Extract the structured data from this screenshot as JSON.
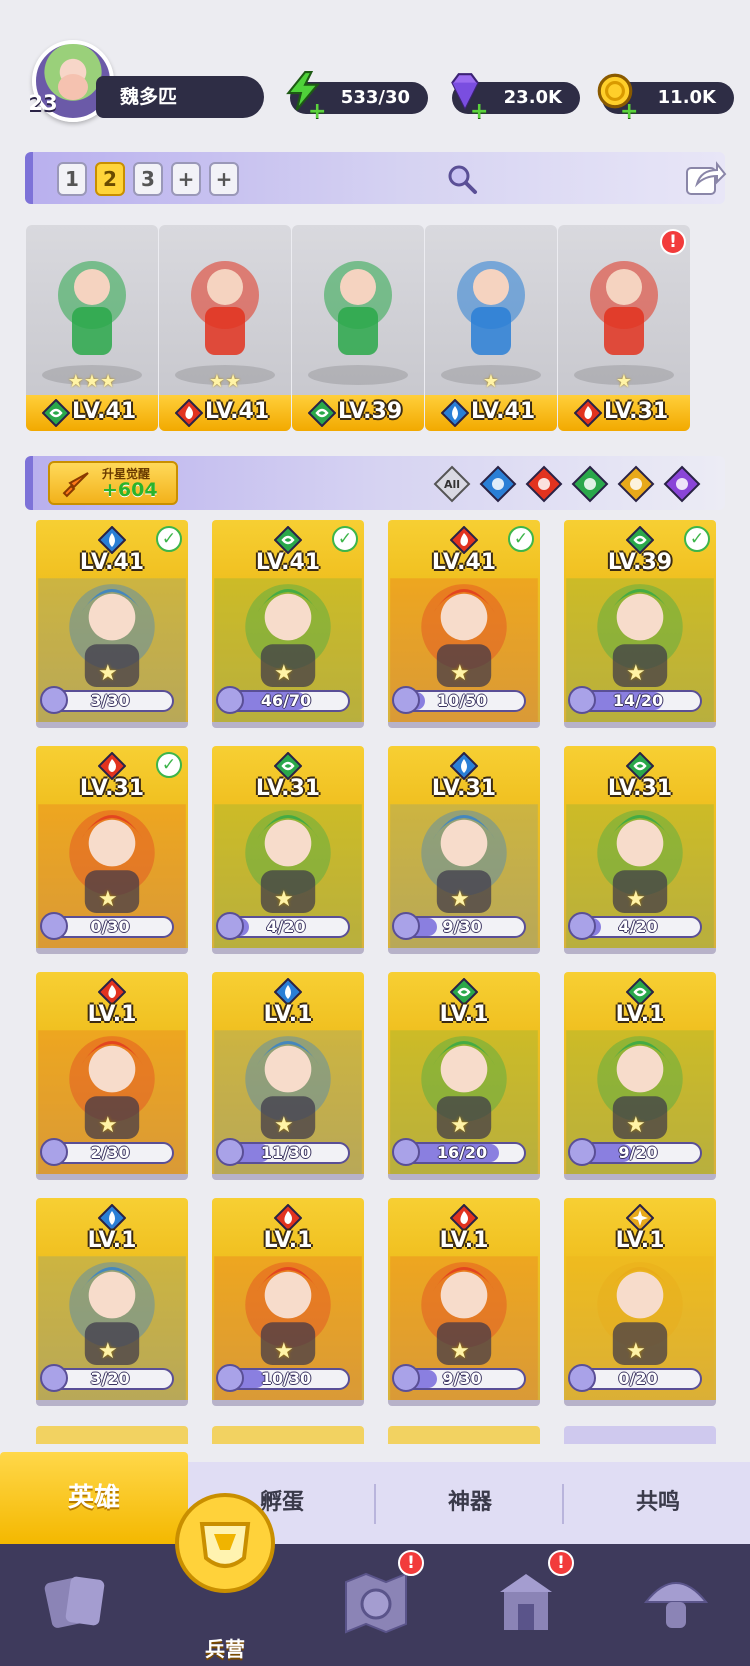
{
  "player": {
    "level": "23",
    "name": "魏多匹"
  },
  "resources": {
    "energy": "533/30",
    "gems": "23.0K",
    "gold": "11.0K"
  },
  "team_bar": {
    "slots": [
      "1",
      "2",
      "3",
      "+",
      "+"
    ],
    "active_slot": "2"
  },
  "team": [
    {
      "level": "LV.41",
      "element": "wind",
      "stars": "★★★",
      "alert": false
    },
    {
      "level": "LV.41",
      "element": "fire",
      "stars": "★★",
      "alert": false
    },
    {
      "level": "LV.39",
      "element": "wind",
      "stars": "",
      "alert": false
    },
    {
      "level": "LV.41",
      "element": "water",
      "stars": "★",
      "alert": false
    },
    {
      "level": "LV.31",
      "element": "fire",
      "stars": "★",
      "alert": true
    }
  ],
  "filter_bar": {
    "awaken_title": "升星觉醒",
    "awaken_count": "+604",
    "filters": [
      "All",
      "water",
      "fire",
      "wind",
      "light",
      "dark"
    ]
  },
  "heroes": [
    {
      "level": "LV.41",
      "element": "water",
      "progress": "3/30",
      "fraction": 0.1,
      "check": true
    },
    {
      "level": "LV.41",
      "element": "wind",
      "progress": "46/70",
      "fraction": 0.66,
      "check": true
    },
    {
      "level": "LV.41",
      "element": "fire",
      "progress": "10/50",
      "fraction": 0.2,
      "check": true
    },
    {
      "level": "LV.39",
      "element": "wind",
      "progress": "14/20",
      "fraction": 0.7,
      "check": true
    },
    {
      "level": "LV.31",
      "element": "fire",
      "progress": "0/30",
      "fraction": 0.0,
      "check": true
    },
    {
      "level": "LV.31",
      "element": "wind",
      "progress": "4/20",
      "fraction": 0.2,
      "check": false
    },
    {
      "level": "LV.31",
      "element": "water",
      "progress": "9/30",
      "fraction": 0.3,
      "check": false
    },
    {
      "level": "LV.31",
      "element": "wind",
      "progress": "4/20",
      "fraction": 0.2,
      "check": false
    },
    {
      "level": "LV.1",
      "element": "fire",
      "progress": "2/30",
      "fraction": 0.07,
      "check": false
    },
    {
      "level": "LV.1",
      "element": "water",
      "progress": "11/30",
      "fraction": 0.37,
      "check": false
    },
    {
      "level": "LV.1",
      "element": "wind",
      "progress": "16/20",
      "fraction": 0.8,
      "check": false
    },
    {
      "level": "LV.1",
      "element": "wind",
      "progress": "9/20",
      "fraction": 0.45,
      "check": false
    },
    {
      "level": "LV.1",
      "element": "water",
      "progress": "3/20",
      "fraction": 0.15,
      "check": false
    },
    {
      "level": "LV.1",
      "element": "fire",
      "progress": "10/30",
      "fraction": 0.33,
      "check": false
    },
    {
      "level": "LV.1",
      "element": "fire",
      "progress": "9/30",
      "fraction": 0.3,
      "check": false
    },
    {
      "level": "LV.1",
      "element": "light",
      "progress": "0/20",
      "fraction": 0.0,
      "check": false
    }
  ],
  "subtabs": [
    "英雄",
    "孵蛋",
    "神器",
    "共鸣"
  ],
  "bottom_nav": [
    {
      "label": "",
      "icon": "cards-icon",
      "alert": false
    },
    {
      "label": "兵营",
      "icon": "barracks-icon",
      "alert": false,
      "active": true
    },
    {
      "label": "",
      "icon": "map-icon",
      "alert": true
    },
    {
      "label": "",
      "icon": "temple-icon",
      "alert": true
    },
    {
      "label": "",
      "icon": "mushroom-icon",
      "alert": false
    }
  ],
  "colors": {
    "fire": "#e2331f",
    "water": "#2a7fd6",
    "wind": "#2aa84a",
    "light": "#e8a91a",
    "dark": "#8a45d8",
    "gold": "#f5c023",
    "panel": "#2e2d45"
  }
}
